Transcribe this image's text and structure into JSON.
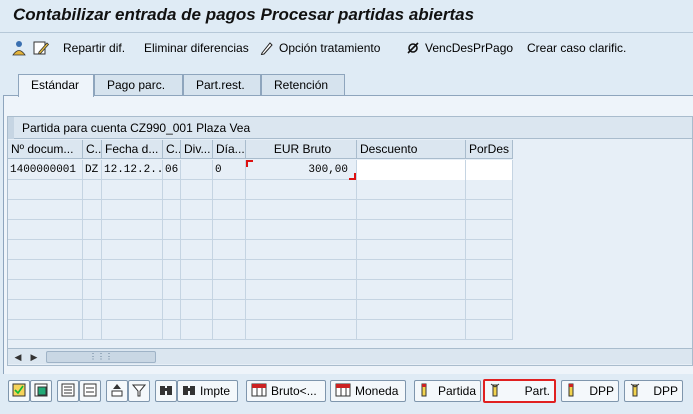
{
  "window": {
    "title": "Contabilizar entrada de pagos Procesar partidas abiertas"
  },
  "toolbar": {
    "items": [
      {
        "icon": "user-distribute-icon"
      },
      {
        "icon": "edit-icon"
      },
      {
        "label": "Repartir dif."
      },
      {
        "label": "Eliminar diferencias"
      },
      {
        "label": "Opción tratamiento",
        "icon": "pencil-icon"
      },
      {
        "label": "VencDesPrPago",
        "icon": "null-icon"
      },
      {
        "label": "Crear caso clarific."
      }
    ]
  },
  "tabs": [
    {
      "label": "Estándar",
      "active": true
    },
    {
      "label": "Pago parc.",
      "active": false
    },
    {
      "label": "Part.rest.",
      "active": false
    },
    {
      "label": "Retención",
      "active": false
    }
  ],
  "grid": {
    "title": "Partida para cuenta CZ990_001 Plaza Vea",
    "columns": [
      "Nº docum...",
      "C...",
      "Fecha d...",
      "C...",
      "Div...",
      "Día...",
      "EUR Bruto",
      "Descuento",
      "PorDes"
    ],
    "rows": [
      [
        "1400000001",
        "DZ",
        "12.12.2...",
        "06",
        "",
        "0",
        "300,00",
        "",
        ""
      ]
    ]
  },
  "bottom_buttons": [
    {
      "icon": "select-all-icon"
    },
    {
      "icon": "select-block-icon"
    },
    {
      "icon": "activate-items-icon"
    },
    {
      "icon": "deactivate-items-icon"
    },
    {
      "icon": "sort-icon"
    },
    {
      "icon": "filter-icon"
    },
    {
      "icon": "binoculars-icon"
    },
    {
      "label": "Impte",
      "icon": "binoculars-icon"
    },
    {
      "label": "Bruto<...",
      "icon": "sort-grid-icon"
    },
    {
      "label": "Moneda",
      "icon": "sort-grid-icon"
    },
    {
      "label": "Partida",
      "icon": "pen-item-icon"
    },
    {
      "label": "Part.",
      "icon": "pen-item-icon",
      "highlighted": true
    },
    {
      "label": "DPP",
      "icon": "pen-item-icon"
    },
    {
      "label": "DPP",
      "icon": "pen-item-icon"
    }
  ],
  "colors": {
    "background": "#dfebf5",
    "highlight_border": "#e02020",
    "selection_corner": "#d11111"
  }
}
